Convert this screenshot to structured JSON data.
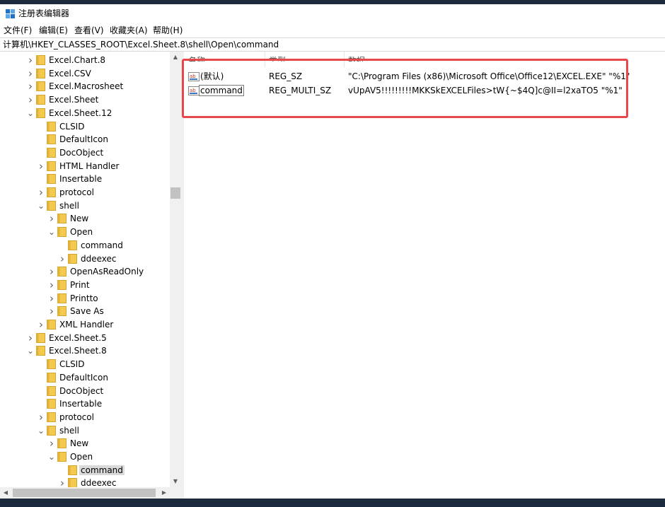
{
  "window": {
    "title": "注册表编辑器"
  },
  "menu": [
    "文件(F)",
    "编辑(E)",
    "查看(V)",
    "收藏夹(A)",
    "帮助(H)"
  ],
  "address": "计算机\\HKEY_CLASSES_ROOT\\Excel.Sheet.8\\shell\\Open\\command",
  "columns": {
    "name": "名称",
    "type": "类型",
    "data": "数据"
  },
  "values": [
    {
      "name": "(默认)",
      "type": "REG_SZ",
      "data": "\"C:\\Program Files (x86)\\Microsoft Office\\Office12\\EXCEL.EXE\" \"%1\""
    },
    {
      "name": "command",
      "type": "REG_MULTI_SZ",
      "data": "vUpAV5!!!!!!!!!MKKSkEXCELFiles>tW{~$4Q]c@II=l2xaTO5 \"%1\""
    }
  ],
  "tree": [
    {
      "label": "Excel.Chart.8",
      "level": 0,
      "state": "collapsed"
    },
    {
      "label": "Excel.CSV",
      "level": 0,
      "state": "collapsed"
    },
    {
      "label": "Excel.Macrosheet",
      "level": 0,
      "state": "collapsed"
    },
    {
      "label": "Excel.Sheet",
      "level": 0,
      "state": "collapsed"
    },
    {
      "label": "Excel.Sheet.12",
      "level": 0,
      "state": "expanded"
    },
    {
      "label": "CLSID",
      "level": 1,
      "state": "leaf"
    },
    {
      "label": "DefaultIcon",
      "level": 1,
      "state": "leaf"
    },
    {
      "label": "DocObject",
      "level": 1,
      "state": "leaf"
    },
    {
      "label": "HTML Handler",
      "level": 1,
      "state": "collapsed"
    },
    {
      "label": "Insertable",
      "level": 1,
      "state": "leaf"
    },
    {
      "label": "protocol",
      "level": 1,
      "state": "collapsed"
    },
    {
      "label": "shell",
      "level": 1,
      "state": "expanded"
    },
    {
      "label": "New",
      "level": 2,
      "state": "collapsed"
    },
    {
      "label": "Open",
      "level": 2,
      "state": "expanded"
    },
    {
      "label": "command",
      "level": 3,
      "state": "leaf"
    },
    {
      "label": "ddeexec",
      "level": 3,
      "state": "collapsed"
    },
    {
      "label": "OpenAsReadOnly",
      "level": 2,
      "state": "collapsed"
    },
    {
      "label": "Print",
      "level": 2,
      "state": "collapsed"
    },
    {
      "label": "Printto",
      "level": 2,
      "state": "collapsed"
    },
    {
      "label": "Save As",
      "level": 2,
      "state": "collapsed"
    },
    {
      "label": "XML Handler",
      "level": 1,
      "state": "collapsed"
    },
    {
      "label": "Excel.Sheet.5",
      "level": 0,
      "state": "collapsed"
    },
    {
      "label": "Excel.Sheet.8",
      "level": 0,
      "state": "expanded"
    },
    {
      "label": "CLSID",
      "level": 1,
      "state": "leaf"
    },
    {
      "label": "DefaultIcon",
      "level": 1,
      "state": "leaf"
    },
    {
      "label": "DocObject",
      "level": 1,
      "state": "leaf"
    },
    {
      "label": "Insertable",
      "level": 1,
      "state": "leaf"
    },
    {
      "label": "protocol",
      "level": 1,
      "state": "collapsed"
    },
    {
      "label": "shell",
      "level": 1,
      "state": "expanded"
    },
    {
      "label": "New",
      "level": 2,
      "state": "collapsed"
    },
    {
      "label": "Open",
      "level": 2,
      "state": "expanded"
    },
    {
      "label": "command",
      "level": 3,
      "state": "leaf",
      "selected": true
    },
    {
      "label": "ddeexec",
      "level": 3,
      "state": "collapsed"
    }
  ],
  "colors": {
    "highlight_box": "#e8474c",
    "selection": "#d9d9d9",
    "folder": "#f3c94f"
  }
}
